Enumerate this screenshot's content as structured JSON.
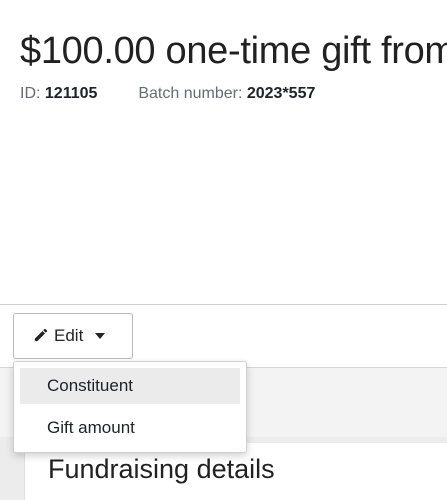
{
  "header": {
    "title": "$100.00 one-time gift from",
    "id_label": "ID:",
    "id_value": "121105",
    "batch_label": "Batch number:",
    "batch_value": "2023*557"
  },
  "toolbar": {
    "edit_label": "Edit",
    "edit_icon": "pencil-icon",
    "caret_icon": "caret-down-icon"
  },
  "edit_menu": {
    "items": [
      {
        "label": "Constituent",
        "highlighted": true
      },
      {
        "label": "Gift amount",
        "highlighted": false
      }
    ]
  },
  "sections": {
    "fundraising_heading": "Fundraising details"
  },
  "colors": {
    "title_text": "#212121",
    "meta_label": "#686c73",
    "menu_highlight": "#ebebeb",
    "content_background": "#ececec"
  }
}
